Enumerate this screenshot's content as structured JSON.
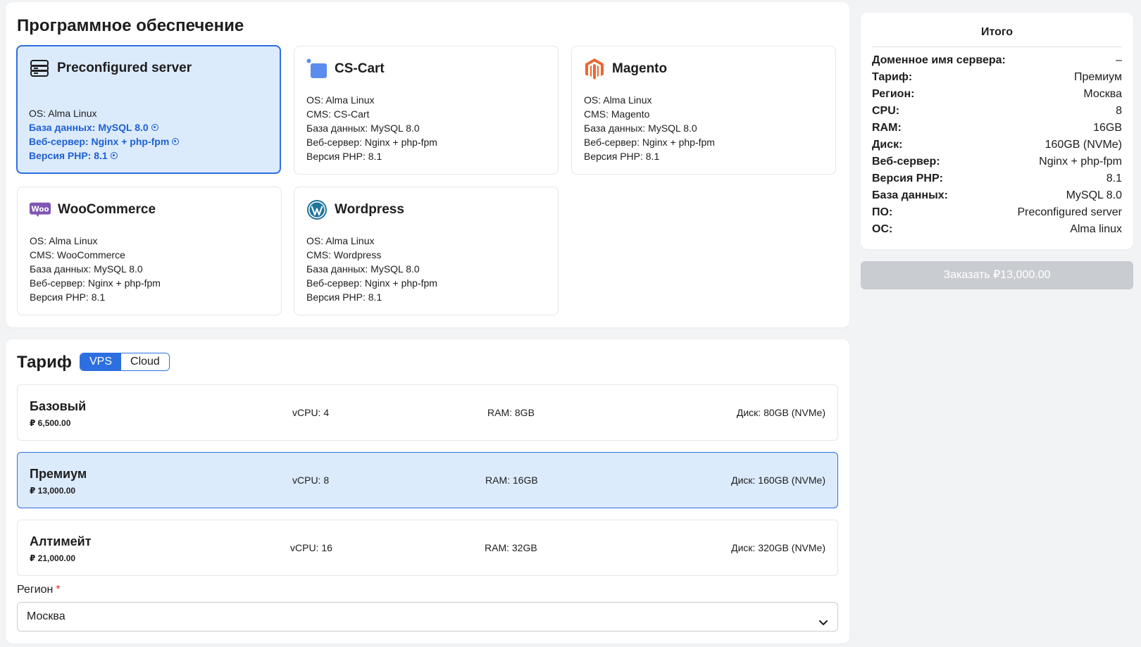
{
  "software": {
    "title": "Программное обеспечение",
    "cards": [
      {
        "name": "Preconfigured server",
        "icon": "server-stack-icon",
        "specs": [
          "OS: Alma Linux",
          "База данных: MySQL 8.0",
          "Веб-сервер: Nginx + php-fpm",
          "Версия PHP: 8.1"
        ],
        "selected": true
      },
      {
        "name": "CS-Cart",
        "icon": "cs-cart-icon",
        "specs": [
          "OS: Alma Linux",
          "CMS: CS-Cart",
          "База данных: MySQL 8.0",
          "Веб-сервер: Nginx + php-fpm",
          "Версия PHP: 8.1"
        ]
      },
      {
        "name": "Magento",
        "icon": "magento-icon",
        "specs": [
          "OS: Alma Linux",
          "CMS: Magento",
          "База данных: MySQL 8.0",
          "Веб-сервер: Nginx + php-fpm",
          "Версия PHP: 8.1"
        ]
      },
      {
        "name": "WooCommerce",
        "icon": "woocommerce-icon",
        "logo_text": "Woo",
        "specs": [
          "OS: Alma Linux",
          "CMS: WooCommerce",
          "База данных: MySQL 8.0",
          "Веб-сервер: Nginx + php-fpm",
          "Версия PHP: 8.1"
        ]
      },
      {
        "name": "Wordpress",
        "icon": "wordpress-icon",
        "specs": [
          "OS: Alma Linux",
          "CMS: Wordpress",
          "База данных: MySQL 8.0",
          "Веб-сервер: Nginx + php-fpm",
          "Версия PHP: 8.1"
        ]
      }
    ]
  },
  "tariff": {
    "title": "Тариф",
    "types": [
      "VPS",
      "Cloud"
    ],
    "active_type": "VPS",
    "plans": [
      {
        "name": "Базовый",
        "price": "₽ 6,500.00",
        "cpu": "vCPU: 4",
        "ram": "RAM: 8GB",
        "disk": "Диск: 80GB (NVMe)"
      },
      {
        "name": "Премиум",
        "price": "₽ 13,000.00",
        "cpu": "vCPU: 8",
        "ram": "RAM: 16GB",
        "disk": "Диск: 160GB (NVMe)",
        "selected": true
      },
      {
        "name": "Алтимейт",
        "price": "₽ 21,000.00",
        "cpu": "vCPU: 16",
        "ram": "RAM: 32GB",
        "disk": "Диск: 320GB (NVMe)"
      }
    ],
    "region_label": "Регион",
    "region_required_mark": "*",
    "region_value": "Москва"
  },
  "summary": {
    "title": "Итого",
    "rows": [
      {
        "key": "Доменное имя сервера:",
        "value": "–"
      },
      {
        "key": "Тариф:",
        "value": "Премиум"
      },
      {
        "key": "Регион:",
        "value": "Москва"
      },
      {
        "key": "CPU:",
        "value": "8"
      },
      {
        "key": "RAM:",
        "value": "16GB"
      },
      {
        "key": "Диск:",
        "value": "160GB (NVMe)"
      },
      {
        "key": "Веб-сервер:",
        "value": "Nginx + php-fpm"
      },
      {
        "key": "Версия PHP:",
        "value": "8.1"
      },
      {
        "key": "База данных:",
        "value": "MySQL 8.0"
      },
      {
        "key": "ПО:",
        "value": "Preconfigured server"
      },
      {
        "key": "ОС:",
        "value": "Alma linux"
      }
    ],
    "order_label": "Заказать ₽13,000.00"
  },
  "colors": {
    "accent": "#2d6fe0",
    "selected_bg": "#dcebfb",
    "magento": "#ee672f",
    "woo": "#7f54b3",
    "wordpress": "#21759b",
    "cscart": "#5b8def"
  }
}
